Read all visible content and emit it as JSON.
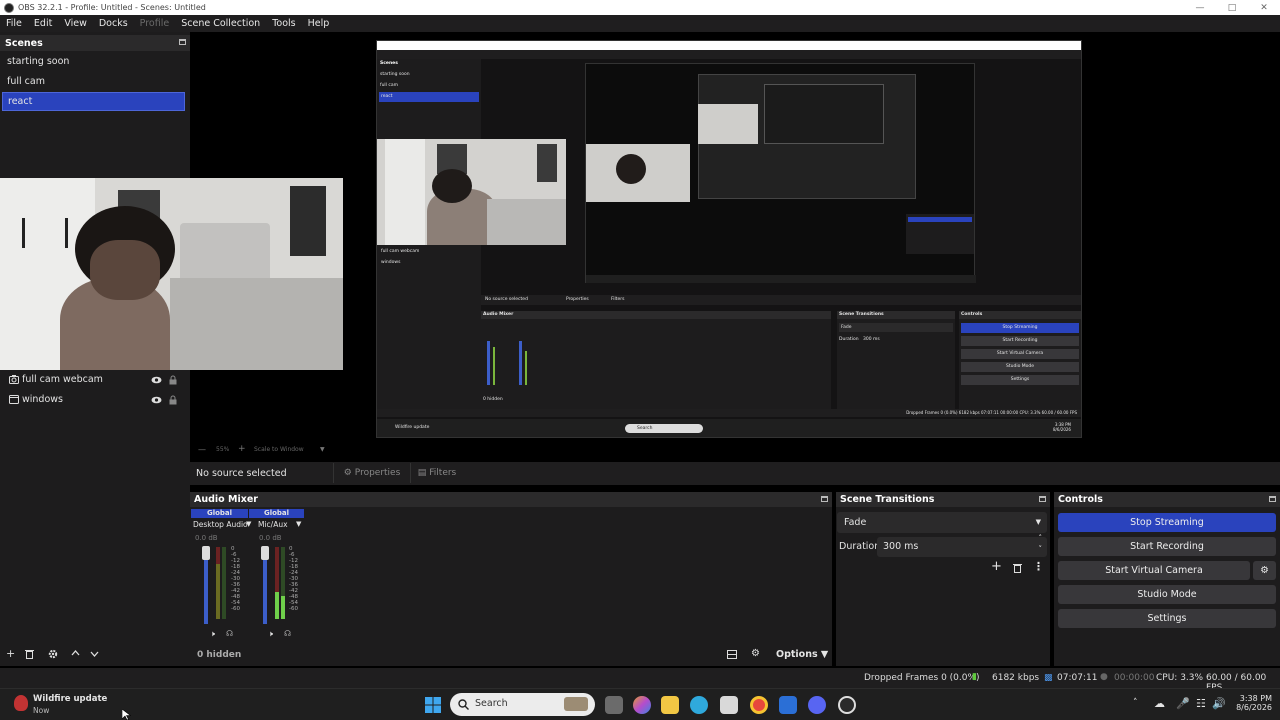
{
  "window": {
    "title": "OBS 32.2.1 - Profile: Untitled - Scenes: Untitled"
  },
  "menu": [
    "File",
    "Edit",
    "View",
    "Docks",
    "Profile",
    "Scene Collection",
    "Tools",
    "Help"
  ],
  "scenes": {
    "title": "Scenes",
    "items": [
      {
        "label": "starting soon",
        "selected": false
      },
      {
        "label": "full cam",
        "selected": false
      },
      {
        "label": "react",
        "selected": true
      }
    ]
  },
  "sources": {
    "items": [
      {
        "label": "full cam webcam",
        "icon": "camera-icon"
      },
      {
        "label": "windows",
        "icon": "window-icon"
      }
    ]
  },
  "preview": {
    "zoom_label": "55%",
    "scale_mode": "Scale to Window"
  },
  "source_toolbar": {
    "no_selection": "No source selected",
    "properties": "Properties",
    "filters": "Filters"
  },
  "audio_mixer": {
    "title": "Audio Mixer",
    "channels": [
      {
        "scope": "Global",
        "name": "Desktop Audio",
        "db": "0.0 dB"
      },
      {
        "scope": "Global",
        "name": "Mic/Aux",
        "db": "0.0 dB"
      }
    ],
    "meter_ticks": [
      "0",
      "-6",
      "-12",
      "-18",
      "-24",
      "-30",
      "-36",
      "-42",
      "-48",
      "-54",
      "-60"
    ],
    "hidden_label": "0 hidden",
    "options_label": "Options"
  },
  "scene_transitions": {
    "title": "Scene Transitions",
    "transition": "Fade",
    "duration_label": "Duration",
    "duration_value": "300 ms"
  },
  "controls": {
    "title": "Controls",
    "buttons": [
      "Stop Streaming",
      "Start Recording",
      "Start Virtual Camera",
      "Studio Mode",
      "Settings"
    ]
  },
  "status": {
    "dropped_frames": "Dropped Frames 0 (0.0%)",
    "bitrate": "6182 kbps",
    "stream_time": "07:07:11",
    "rec_time": "00:00:00",
    "cpu": "CPU: 3.3%",
    "fps": "60.00 / 60.00 FPS"
  },
  "taskbar": {
    "notification_title": "Wildfire update",
    "notification_sub": "Now",
    "search_placeholder": "Search",
    "time": "3:38 PM",
    "date": "8/6/2026"
  },
  "nested_preview": {
    "scenes_title": "Scenes",
    "scene_items": [
      "starting soon",
      "full cam",
      "react"
    ],
    "source_items": [
      "full cam webcam",
      "windows"
    ],
    "no_source": "No source selected",
    "properties": "Properties",
    "filters": "Filters",
    "audio_title": "Audio Mixer",
    "transitions_title": "Scene Transitions",
    "transition": "Fade",
    "duration_label": "Duration",
    "duration_value": "300 ms",
    "controls_title": "Controls",
    "buttons": [
      "Stop Streaming",
      "Start Recording",
      "Start Virtual Camera",
      "Studio Mode",
      "Settings"
    ],
    "hidden": "0 hidden",
    "options": "Options",
    "status": "Dropped Frames 0 (0.0%)   6182 kbps   07:07:11   00:00:00   CPU: 3.3%   60.00 / 60.00 FPS",
    "notification": "Wildfire update",
    "search": "Search",
    "time": "3:38 PM",
    "date": "8/6/2026"
  },
  "colors": {
    "accent": "#2a43bd",
    "panel": "#1d1c1d",
    "header": "#2b2a2b"
  }
}
